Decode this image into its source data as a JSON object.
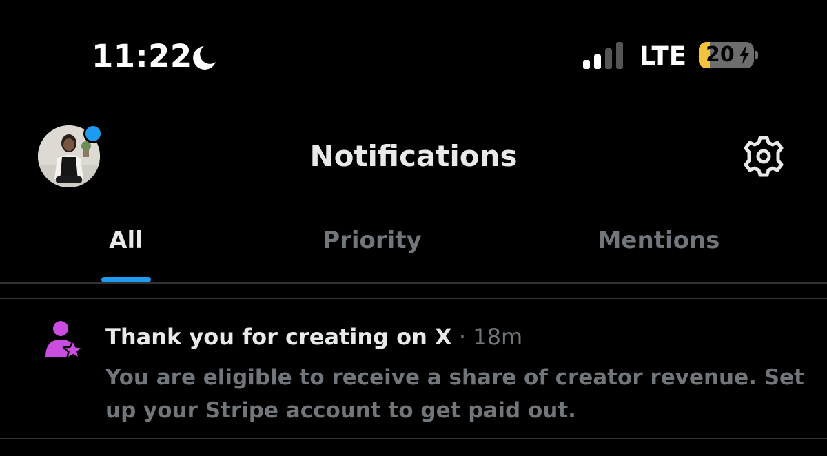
{
  "status_bar": {
    "time": "11:22",
    "network": "LTE",
    "battery_percent": "20",
    "battery_level": 0.2,
    "icons": [
      "moon-icon",
      "signal-icon",
      "bolt-icon"
    ]
  },
  "header": {
    "title": "Notifications",
    "icons": [
      "avatar",
      "gear-icon"
    ]
  },
  "tabs": [
    {
      "label": "All",
      "active": true
    },
    {
      "label": "Priority",
      "active": false
    },
    {
      "label": "Mentions",
      "active": false
    }
  ],
  "notifications": [
    {
      "icon": "creator-star-icon",
      "title": "Thank you for creating on X",
      "separator": "·",
      "time": "18m",
      "body": "You are eligible to receive a share of creator revenue. Set up your Stripe account to get paid out."
    }
  ],
  "colors": {
    "background": "#000000",
    "accent": "#1d9bf0",
    "muted_text": "#71767b",
    "primary_text": "#e7e9ea",
    "creator_icon": "#c94ee0",
    "battery": "#f4c23c"
  }
}
